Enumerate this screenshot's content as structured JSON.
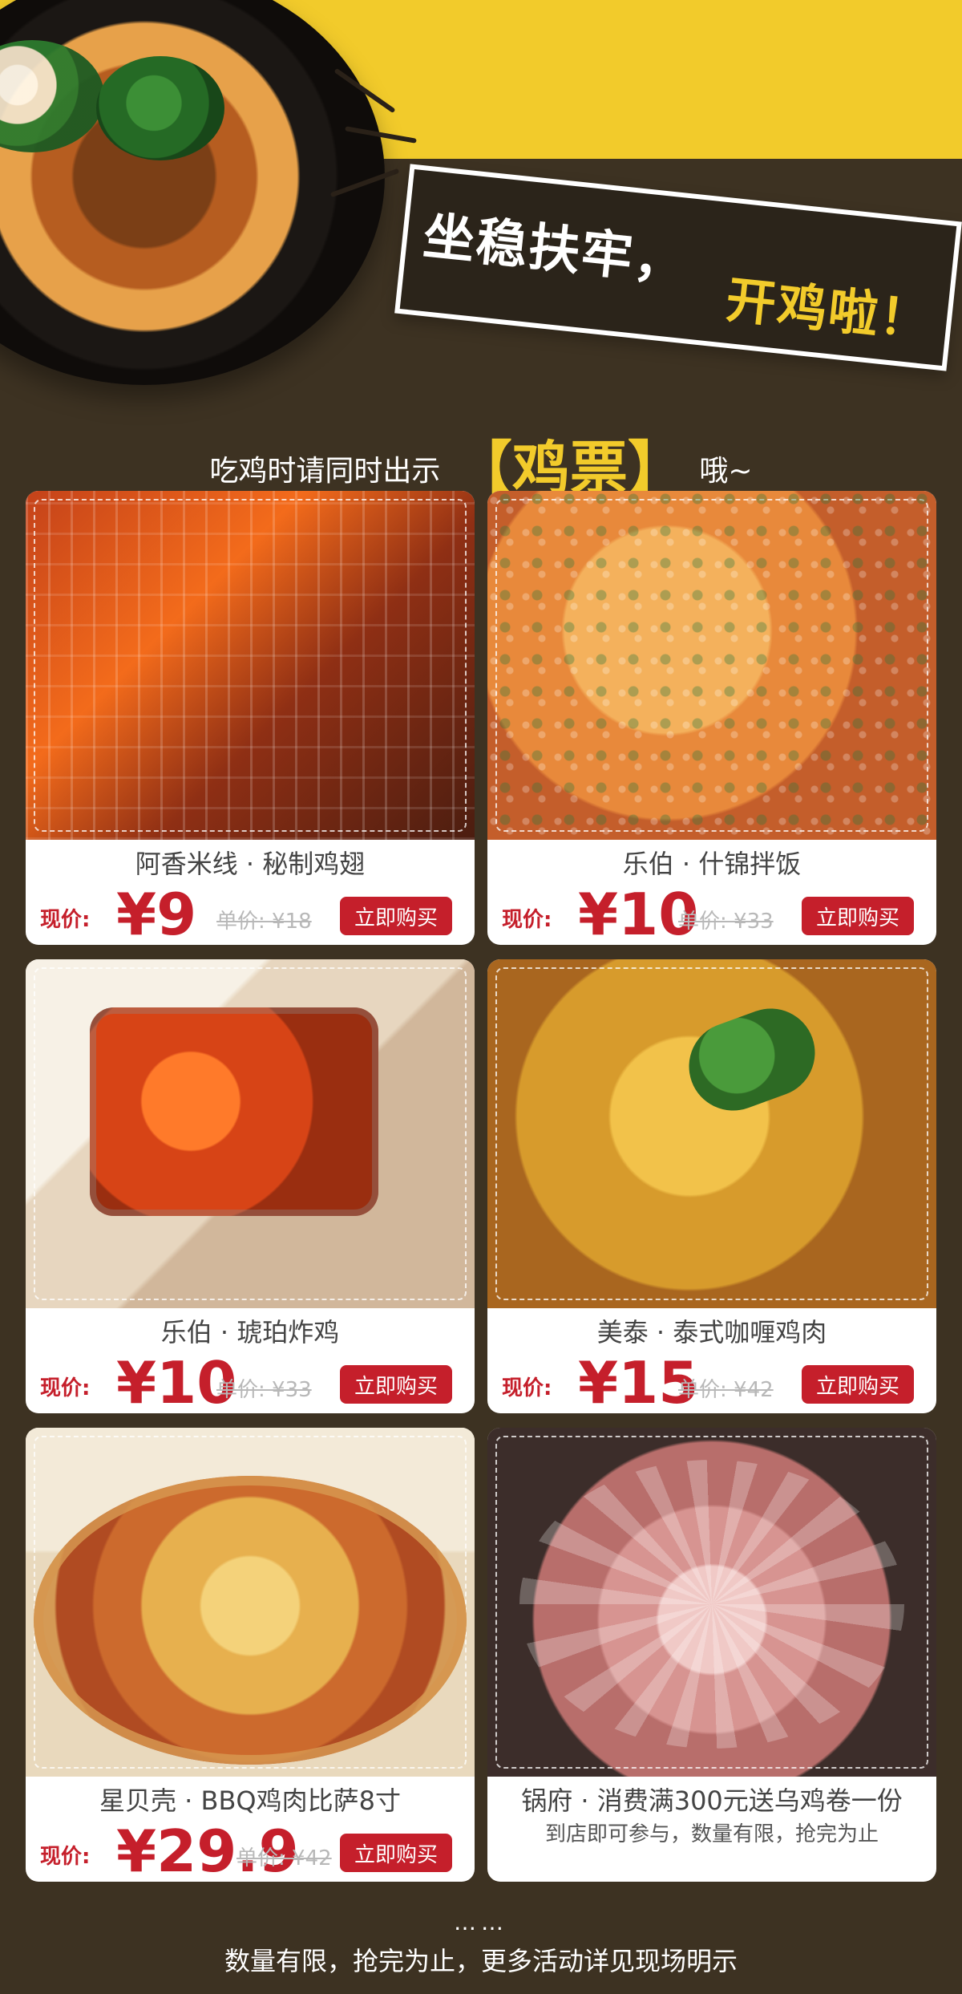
{
  "header": {
    "slogan_main": "坐稳扶牢，",
    "slogan_accent": "开鸡啦！"
  },
  "subtitle": {
    "prefix": "吃鸡时请同时出示",
    "highlight": "鸡票",
    "suffix": "哦~"
  },
  "cards": [
    {
      "title": "阿香米线 · 秘制鸡翅",
      "now_label": "现价:",
      "now_price": "¥9",
      "old_price": "单价: ¥18",
      "buy_label": "立即购买"
    },
    {
      "title": "乐伯 · 什锦拌饭",
      "now_label": "现价:",
      "now_price": "¥10",
      "old_price": "单价: ¥33",
      "buy_label": "立即购买"
    },
    {
      "title": "乐伯 · 琥珀炸鸡",
      "now_label": "现价:",
      "now_price": "¥10",
      "old_price": "单价: ¥33",
      "buy_label": "立即购买"
    },
    {
      "title": "美泰 · 泰式咖喱鸡肉",
      "now_label": "现价:",
      "now_price": "¥15",
      "old_price": "单价: ¥42",
      "buy_label": "立即购买"
    },
    {
      "title": "星贝壳 · BBQ鸡肉比萨8寸",
      "now_label": "现价:",
      "now_price": "¥29.9",
      "old_price": "单价: ¥42",
      "buy_label": "立即购买"
    },
    {
      "title": "锅府 · 消费满300元送乌鸡卷一份",
      "sub": "到店即可参与，数量有限，抢完为止"
    }
  ],
  "footer": {
    "dots": "……",
    "note": "数量有限，抢完为止，更多活动详见现场明示"
  }
}
